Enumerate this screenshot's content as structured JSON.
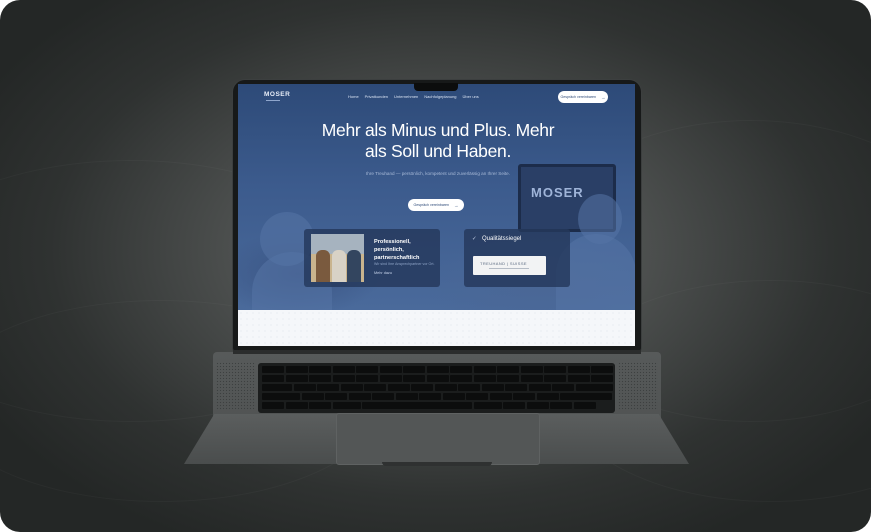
{
  "site": {
    "logo": "MOSER",
    "nav": [
      "Home",
      "Privatkunden",
      "Unternehmen",
      "Nachfolgeplanung",
      "Über uns"
    ],
    "nav_cta": "Gespräch vereinbaren",
    "headline": "Mehr als Minus und Plus. Mehr als Soll und Haben.",
    "subline": "Ihre Treuhand — persönlich, kompetent und zuverlässig an Ihrer Seite.",
    "hero_cta": "Gespräch vereinbaren",
    "card_left": {
      "title": "Professionell, persönlich, partnerschaftlich",
      "text": "Wir sind Ihre Ansprechpartner vor Ort.",
      "link": "Mehr dazu"
    },
    "card_right": {
      "title": "Qualitätssiegel",
      "badge": "TREUHAND | SUISSE"
    },
    "tv_text": "MOSER"
  },
  "colors": {
    "hero": "#2d4a78",
    "accent": "#ffffff",
    "background": "#f5f7fa"
  },
  "icons": [
    "arrow-right-icon",
    "check-icon"
  ]
}
